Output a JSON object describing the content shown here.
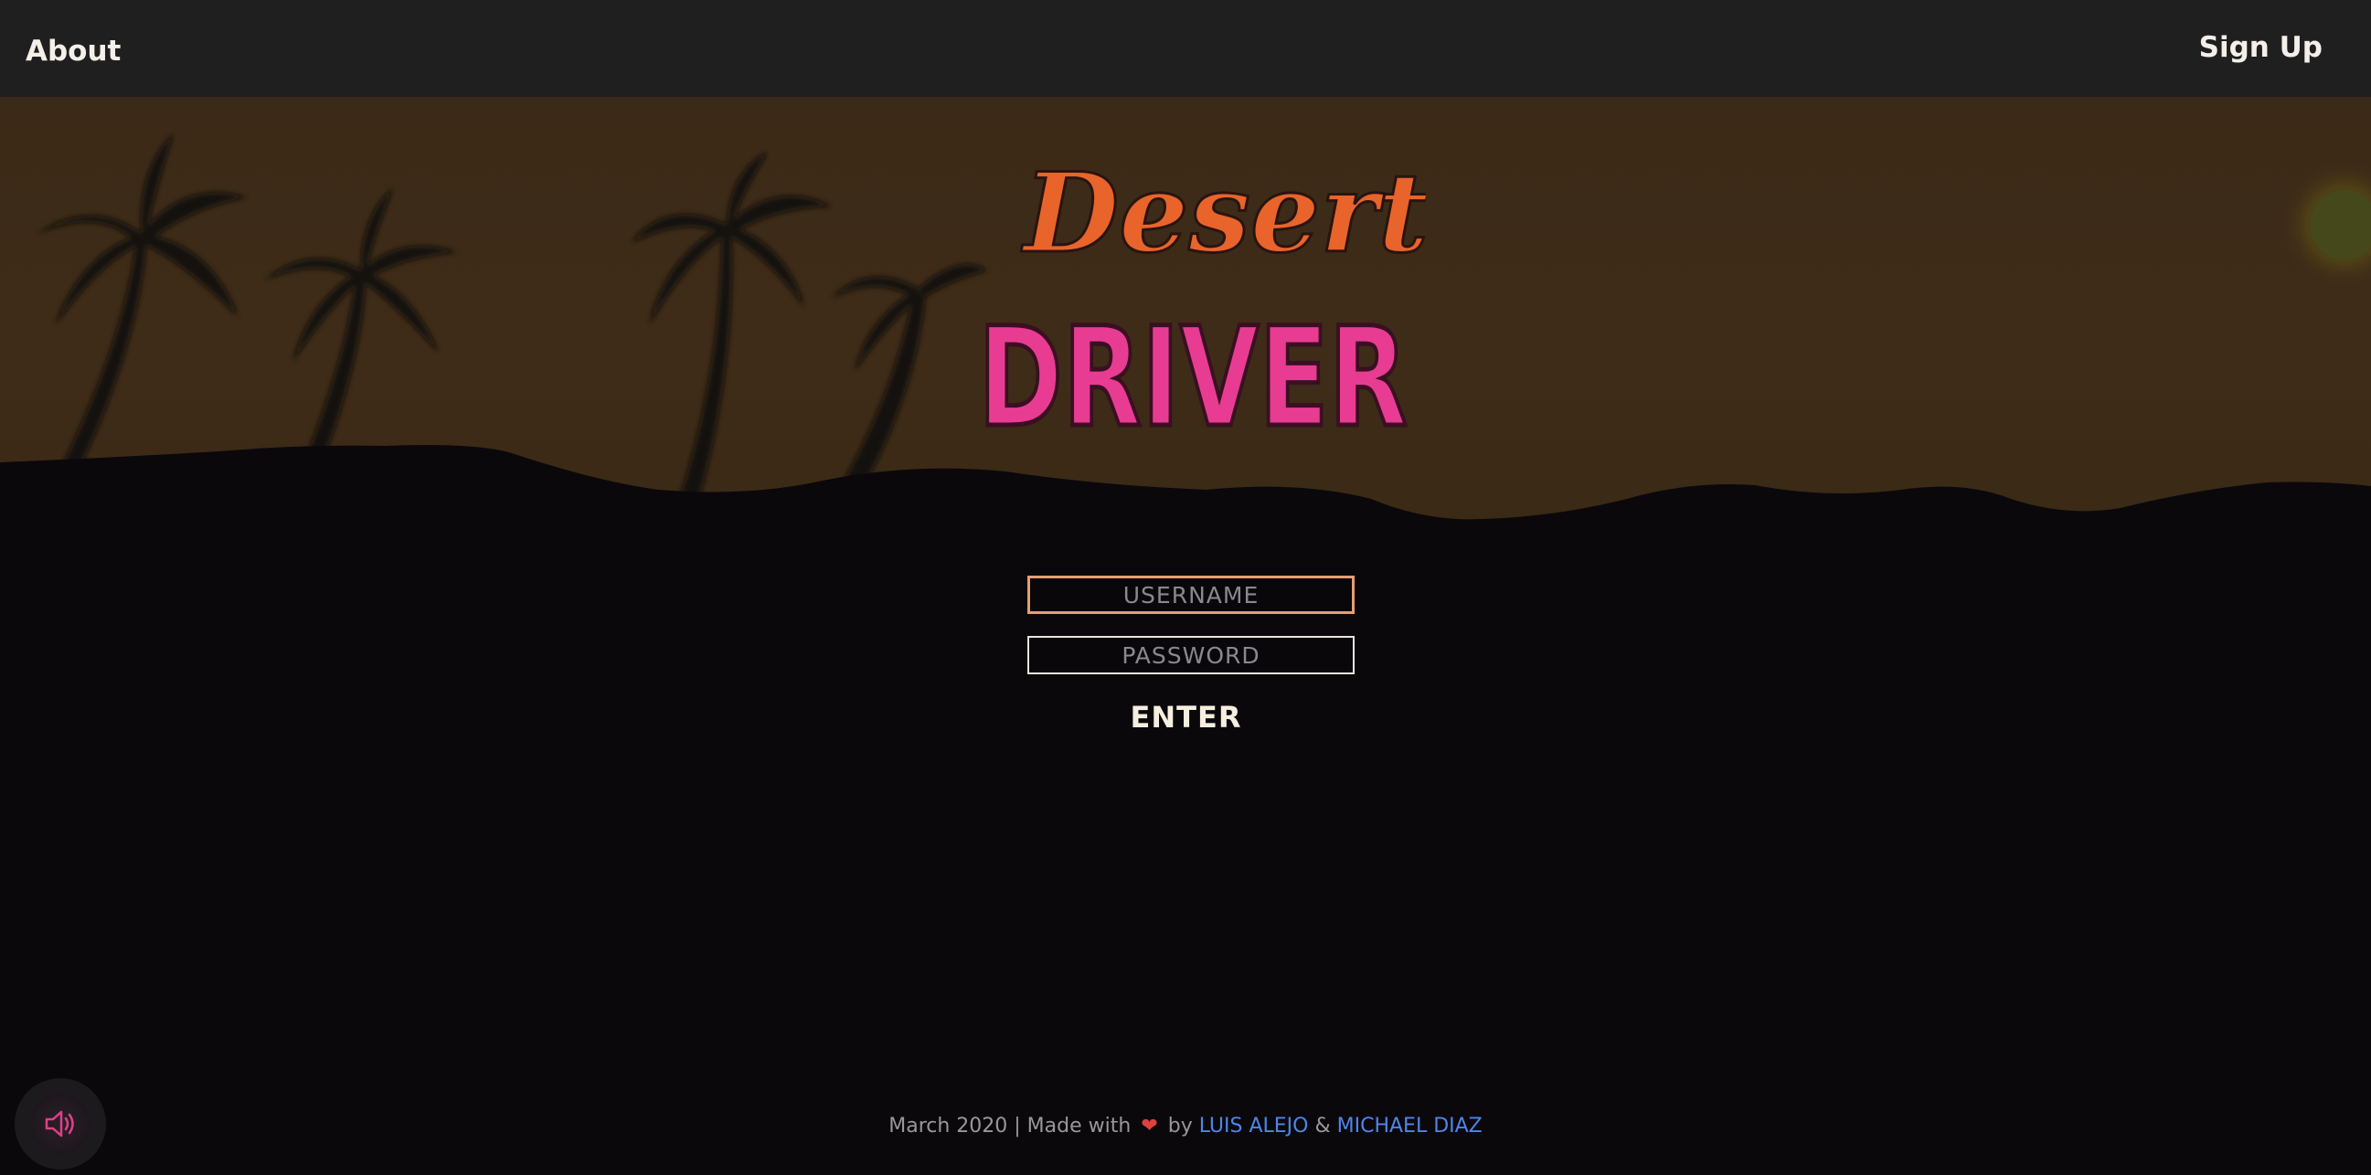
{
  "nav": {
    "about_label": "About",
    "signup_label": "Sign Up"
  },
  "logo": {
    "line1": "Desert",
    "line2": "DRIVER",
    "colors": {
      "script": "#e8642b",
      "block": "#e83c92"
    }
  },
  "form": {
    "username_placeholder": "USERNAME",
    "username_value": "",
    "password_placeholder": "PASSWORD",
    "password_value": "",
    "enter_label": "ENTER"
  },
  "sound": {
    "icon": "speaker-icon"
  },
  "footer": {
    "prefix": "March 2020 | Made with",
    "heart": "❤",
    "by": "by",
    "author1": "LUIS ALEJO",
    "amp": "&",
    "author2": "MICHAEL DIAZ"
  },
  "colors": {
    "topbar": "#201f20",
    "sky": "#3b2a17",
    "ground": "#0b080c",
    "link": "#4f85e8",
    "username_border": "#e59e74"
  }
}
